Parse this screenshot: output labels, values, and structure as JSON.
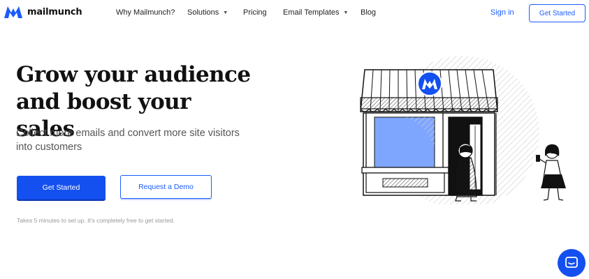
{
  "brand": {
    "name": "mailmunch",
    "accent": "#1a5bff"
  },
  "nav": {
    "items": [
      {
        "label": "Why Mailmunch?",
        "dropdown": false
      },
      {
        "label": "Solutions",
        "dropdown": true
      },
      {
        "label": "Pricing",
        "dropdown": false
      },
      {
        "label": "Email Templates",
        "dropdown": true
      },
      {
        "label": "Blog",
        "dropdown": false
      }
    ],
    "sign_in": "Sign in",
    "cta": "Get Started"
  },
  "hero": {
    "headline_line1": "Grow your audience",
    "headline_line2": "and boost your sales",
    "subheadline": "Collect more emails and convert more site visitors into customers",
    "primary_cta": "Get Started",
    "secondary_cta": "Request a Demo",
    "note": "Takes 5 minutes to set up. It's completely free to get started."
  },
  "icons": {
    "logo": "mailmunch-logo-icon",
    "chevron": "chevron-down-icon",
    "chat": "chat-bubble-icon"
  }
}
